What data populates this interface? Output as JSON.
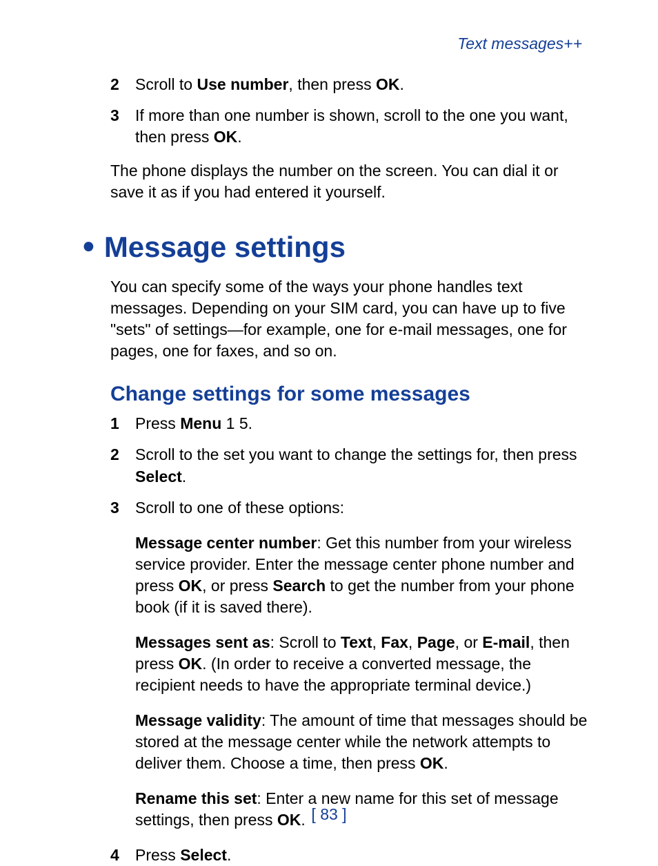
{
  "header": "Text messages++",
  "top_steps": [
    {
      "num": "2",
      "parts": [
        "Scroll to ",
        "Use number",
        ", then press ",
        "OK",
        "."
      ]
    },
    {
      "num": "3",
      "parts": [
        "If more than one number is shown, scroll to the one you want, then press ",
        "OK",
        "."
      ]
    }
  ],
  "top_para": "The phone displays the number on the screen. You can dial it or save it as if you had entered it yourself.",
  "h1": "Message settings",
  "h1_para": "You can specify some of the ways your phone handles text messages. Depending on your SIM card, you can have up to five \"sets\" of settings—for example, one for e-mail messages, one for pages, one for faxes, and so on.",
  "h2": "Change settings for some messages",
  "steps": [
    {
      "num": "1",
      "parts": [
        "Press ",
        "Menu",
        " 1 5."
      ]
    },
    {
      "num": "2",
      "parts": [
        "Scroll to the set you want to change the settings for, then press ",
        "Select",
        "."
      ]
    },
    {
      "num": "3",
      "parts": [
        "Scroll to one of these options:"
      ]
    }
  ],
  "options": [
    {
      "label": "Message center number",
      "text_before": ":  Get this number from your wireless service provider. Enter the message center phone number and press ",
      "bold1": "OK",
      "text_mid1": ", or press ",
      "bold2": "Search",
      "text_after": " to get the number from your phone book (if it is saved there)."
    },
    {
      "label": "Messages sent as",
      "text_before": ":  Scroll to ",
      "bold1": "Text",
      "text_mid1": ", ",
      "bold2": "Fax",
      "text_mid2": ", ",
      "bold3": "Page",
      "text_mid3": ", or ",
      "bold4": "E-mail",
      "text_mid4": ", then press ",
      "bold5": "OK",
      "text_after": ". (In order to receive a converted message, the recipient needs to have the appropriate terminal device.)"
    },
    {
      "label": "Message validity",
      "text_before": ":  The amount of time that messages should be stored at the message center while the network attempts to deliver them. Choose a time, then press ",
      "bold1": "OK",
      "text_after": "."
    },
    {
      "label": "Rename this set",
      "text_before": ":  Enter a new name for this set of message settings, then press ",
      "bold1": "OK",
      "text_after": "."
    }
  ],
  "final_step": {
    "num": "4",
    "parts": [
      "Press ",
      "Select",
      "."
    ]
  },
  "page_number": "[ 83 ]"
}
